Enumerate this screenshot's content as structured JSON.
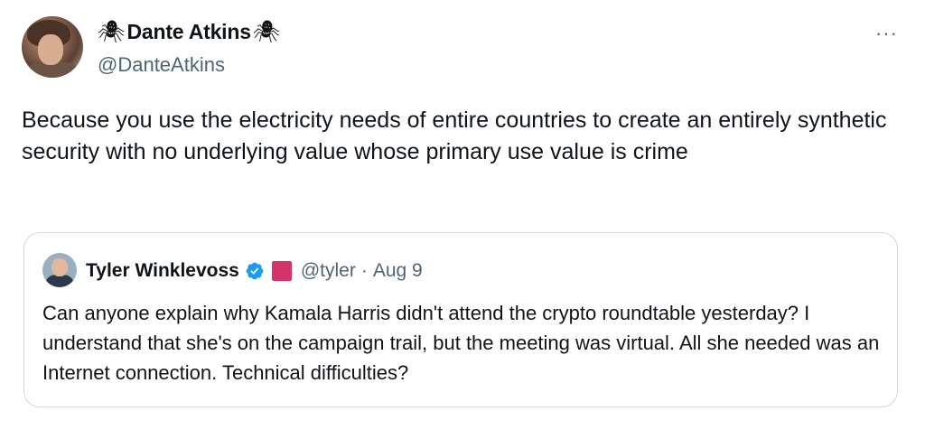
{
  "author": {
    "display_name": "Dante Atkins",
    "handle": "@DanteAtkins",
    "name_emoji": "🕷"
  },
  "more_label": "···",
  "tweet": {
    "text": "Because you use the electricity needs of entire countries to create an entirely synthetic security with no underlying value whose primary use value is crime"
  },
  "quoted": {
    "display_name": "Tyler Winklevoss",
    "handle": "@tyler",
    "separator": "·",
    "date": "Aug 9",
    "text": "Can anyone explain why Kamala Harris didn't attend the crypto roundtable yesterday? I understand that she's on the campaign trail, but the meeting was virtual. All she needed was an Internet connection. Technical difficulties?",
    "badge_color": "#d6336c",
    "verified_color": "#1d9bf0"
  }
}
